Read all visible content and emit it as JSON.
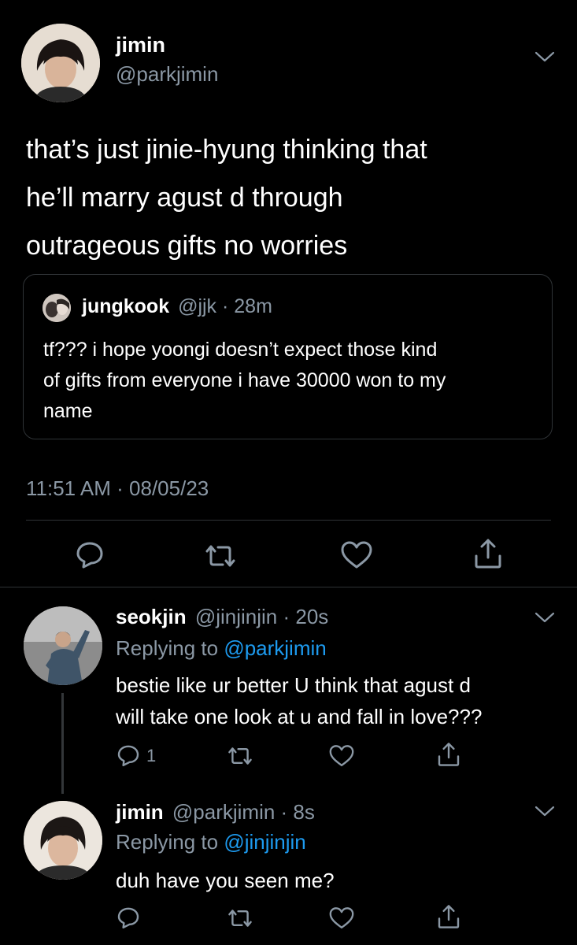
{
  "main_tweet": {
    "name": "jimin",
    "handle": "@parkjimin",
    "text_lines": [
      "that’s just jinie-hyung thinking that",
      "he’ll marry agust d through",
      "outrageous gifts no worries"
    ],
    "timestamp": "11:51 AM · 08/05/23"
  },
  "quoted_tweet": {
    "name": "jungkook",
    "meta": "@jjk · 28m",
    "text_lines": [
      "tf??? i hope yoongi doesn’t expect those kind",
      "of gifts from everyone i have 30000 won to my",
      "name"
    ]
  },
  "reply1": {
    "name": "seokjin",
    "meta": "@jinjinjin · 20s",
    "replying_prefix": "Replying to ",
    "replying_to": "@parkjimin",
    "text_lines": [
      "bestie like ur better U think that agust d",
      "will take one look at u and fall in love???"
    ],
    "reply_count": "1"
  },
  "reply2": {
    "name": "jimin",
    "meta": "@parkjimin · 8s",
    "replying_prefix": "Replying to ",
    "replying_to": "@jinjinjin",
    "text_lines": [
      "duh have you seen me?"
    ]
  },
  "icons": {
    "reply": "reply-icon",
    "retweet": "retweet-icon",
    "like": "heart-icon",
    "share": "share-icon",
    "more": "chevron-down-icon"
  },
  "colors": {
    "background": "#000000",
    "link": "#1d9bf0",
    "muted": "#8b98a5"
  }
}
